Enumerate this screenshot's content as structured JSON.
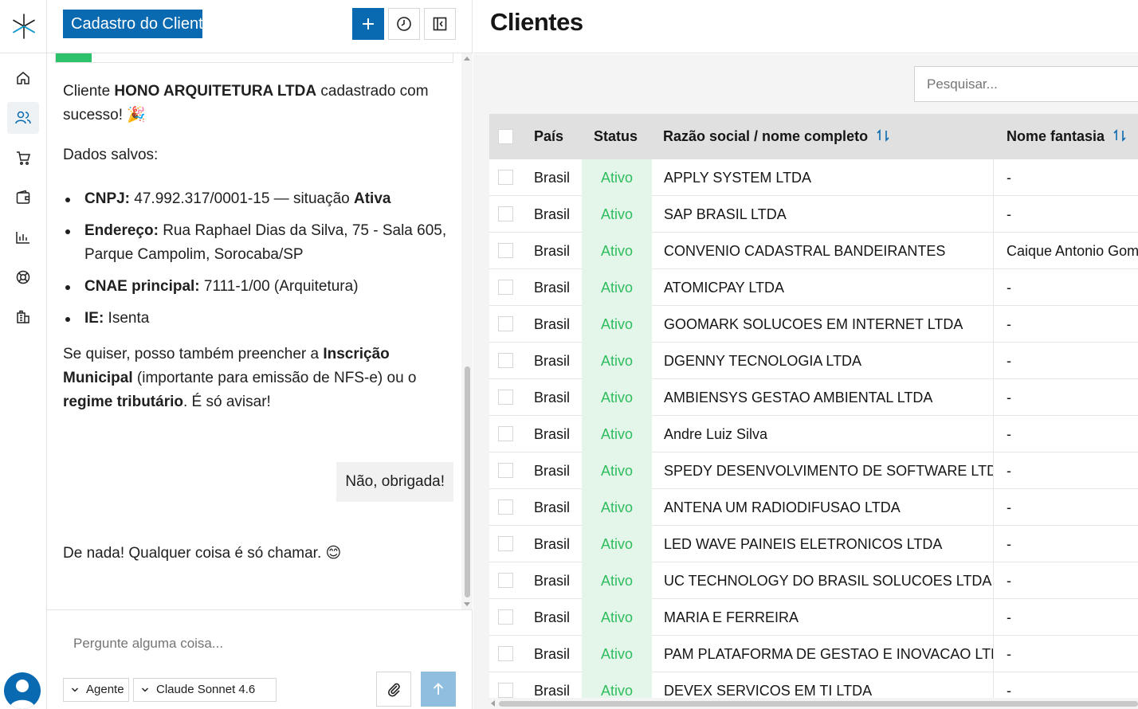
{
  "app": {
    "brand_icon": "asterisk-logo-icon",
    "accent_color": "#0a6ab1",
    "success_color": "#2ebd5f"
  },
  "rail": {
    "items": [
      {
        "name": "home-icon",
        "active": false
      },
      {
        "name": "users-icon",
        "active": true
      },
      {
        "name": "cart-icon",
        "active": false
      },
      {
        "name": "wallet-icon",
        "active": false
      },
      {
        "name": "bar-chart-icon",
        "active": false
      },
      {
        "name": "lifebuoy-icon",
        "active": false
      },
      {
        "name": "building-icon",
        "active": false
      }
    ]
  },
  "chat": {
    "title": "Cadastro do Client",
    "progress_fraction": 0.09,
    "assistant_msg1": {
      "intro_a": "Cliente ",
      "intro_b": "HONO ARQUITETURA LTDA",
      "intro_c": " cadastrado com sucesso! 🎉",
      "saved_label": "Dados salvos:",
      "items": [
        {
          "label": "CNPJ:",
          "value": " 47.992.317/0001-15 — situação ",
          "extra": "Ativa"
        },
        {
          "label": "Endereço:",
          "value": " Rua Raphael Dias da Silva, 75 - Sala 605, Parque Campolim, Sorocaba/SP",
          "extra": ""
        },
        {
          "label": "CNAE principal:",
          "value": " 7111-1/00 (Arquitetura)",
          "extra": ""
        },
        {
          "label": "IE:",
          "value": " Isenta",
          "extra": ""
        }
      ],
      "outro_a": "Se quiser, posso também preencher a ",
      "outro_b": "Inscrição Municipal",
      "outro_c": " (importante para emissão de NFS-e) ou o ",
      "outro_d": "regime tributário",
      "outro_e": ". É só avisar!"
    },
    "user_msg": "Não, obrigada!",
    "assistant_msg2": "De nada! Qualquer coisa é só chamar. 😊",
    "composer": {
      "placeholder": "Pergunte alguma coisa...",
      "mode": "Agente",
      "model": "Claude Sonnet 4.6"
    }
  },
  "clients": {
    "title": "Clientes",
    "search_placeholder": "Pesquisar...",
    "columns": {
      "country": "País",
      "status": "Status",
      "razao": "Razão social / nome completo",
      "fantasia": "Nome fantasia"
    },
    "rows": [
      {
        "country": "Brasil",
        "status": "Ativo",
        "razao": "APPLY SYSTEM LTDA",
        "fantasia": "-"
      },
      {
        "country": "Brasil",
        "status": "Ativo",
        "razao": "SAP BRASIL LTDA",
        "fantasia": "-"
      },
      {
        "country": "Brasil",
        "status": "Ativo",
        "razao": "CONVENIO CADASTRAL BANDEIRANTES",
        "fantasia": "Caique Antonio Gome"
      },
      {
        "country": "Brasil",
        "status": "Ativo",
        "razao": "ATOMICPAY LTDA",
        "fantasia": "-"
      },
      {
        "country": "Brasil",
        "status": "Ativo",
        "razao": "GOOMARK SOLUCOES EM INTERNET LTDA",
        "fantasia": "-"
      },
      {
        "country": "Brasil",
        "status": "Ativo",
        "razao": "DGENNY TECNOLOGIA LTDA",
        "fantasia": "-"
      },
      {
        "country": "Brasil",
        "status": "Ativo",
        "razao": "AMBIENSYS GESTAO AMBIENTAL LTDA",
        "fantasia": "-"
      },
      {
        "country": "Brasil",
        "status": "Ativo",
        "razao": "Andre Luiz Silva",
        "fantasia": "-"
      },
      {
        "country": "Brasil",
        "status": "Ativo",
        "razao": "SPEDY DESENVOLVIMENTO DE SOFTWARE LTDA",
        "fantasia": "-"
      },
      {
        "country": "Brasil",
        "status": "Ativo",
        "razao": "ANTENA UM RADIODIFUSAO LTDA",
        "fantasia": "-"
      },
      {
        "country": "Brasil",
        "status": "Ativo",
        "razao": "LED WAVE PAINEIS ELETRONICOS LTDA",
        "fantasia": "-"
      },
      {
        "country": "Brasil",
        "status": "Ativo",
        "razao": "UC TECHNOLOGY DO BRASIL SOLUCOES LTDA",
        "fantasia": "-"
      },
      {
        "country": "Brasil",
        "status": "Ativo",
        "razao": "MARIA E FERREIRA",
        "fantasia": "-"
      },
      {
        "country": "Brasil",
        "status": "Ativo",
        "razao": "PAM PLATAFORMA DE GESTAO E INOVACAO LTDA",
        "fantasia": "-"
      },
      {
        "country": "Brasil",
        "status": "Ativo",
        "razao": "DEVEX SERVICOS EM TI LTDA",
        "fantasia": "-"
      }
    ]
  }
}
